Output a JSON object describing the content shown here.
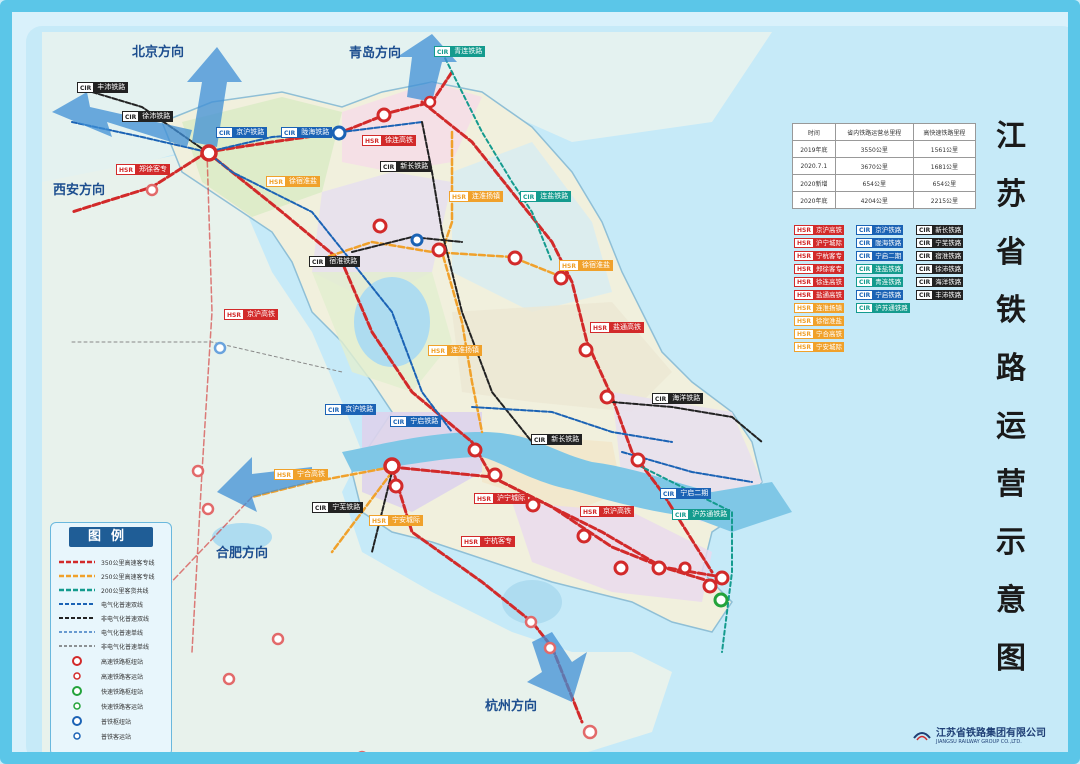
{
  "title_chars": [
    "江",
    "苏",
    "省",
    "铁",
    "路",
    "运",
    "营",
    "示",
    "意",
    "图"
  ],
  "directions": {
    "beijing": "北京方向",
    "qingdao": "青岛方向",
    "xian": "西安方向",
    "hefei": "合肥方向",
    "hangzhou": "杭州方向"
  },
  "stats_table": {
    "headers": [
      "时间",
      "省内铁路运营总里程",
      "高快速铁路里程"
    ],
    "rows": [
      [
        "2019年底",
        "3550公里",
        "1561公里"
      ],
      [
        "2020.7.1",
        "3670公里",
        "1681公里"
      ],
      [
        "2020新增",
        "654公里",
        "654公里"
      ],
      [
        "2020年底",
        "4204公里",
        "2215公里"
      ]
    ]
  },
  "line_tags": {
    "col1": [
      {
        "pre": "HSR",
        "name": "京沪高铁",
        "style": "hsr"
      },
      {
        "pre": "HSR",
        "name": "沪宁城际",
        "style": "hsr"
      },
      {
        "pre": "HSR",
        "name": "宁杭客专",
        "style": "hsr"
      },
      {
        "pre": "HSR",
        "name": "郑徐客专",
        "style": "hsr"
      },
      {
        "pre": "HSR",
        "name": "徐连高铁",
        "style": "hsr"
      },
      {
        "pre": "HSR",
        "name": "盐通高铁",
        "style": "hsr"
      },
      {
        "pre": "HSR",
        "name": "连淮扬镇",
        "style": "org"
      },
      {
        "pre": "HSR",
        "name": "徐宿淮盐",
        "style": "org"
      },
      {
        "pre": "HSR",
        "name": "宁合高铁",
        "style": "org"
      },
      {
        "pre": "HSR",
        "name": "宁安城际",
        "style": "org"
      }
    ],
    "col2": [
      {
        "pre": "CIR",
        "name": "京沪铁路",
        "style": "cirb"
      },
      {
        "pre": "CIR",
        "name": "陇海铁路",
        "style": "cirb"
      },
      {
        "pre": "CIR",
        "name": "宁启二期",
        "style": "cirb"
      },
      {
        "pre": "CIR",
        "name": "连盐铁路",
        "style": "cirt"
      },
      {
        "pre": "CIR",
        "name": "青连铁路",
        "style": "cirt"
      },
      {
        "pre": "CIR",
        "name": "宁启铁路",
        "style": "cirb"
      },
      {
        "pre": "CIR",
        "name": "沪苏通铁路",
        "style": "cirt"
      }
    ],
    "col3": [
      {
        "pre": "CIR",
        "name": "新长铁路",
        "style": "cir"
      },
      {
        "pre": "CIR",
        "name": "宁芜铁路",
        "style": "cir"
      },
      {
        "pre": "CIR",
        "name": "宿淮铁路",
        "style": "cir"
      },
      {
        "pre": "CIR",
        "name": "徐沛铁路",
        "style": "cir"
      },
      {
        "pre": "CIR",
        "name": "海洋铁路",
        "style": "cir"
      },
      {
        "pre": "CIR",
        "name": "丰沛铁路",
        "style": "cir"
      }
    ]
  },
  "map_labels": [
    {
      "id": "fengpei",
      "pre": "CIR",
      "name": "丰沛铁路",
      "style": "cir"
    },
    {
      "id": "xupei",
      "pre": "CIR",
      "name": "徐沛铁路",
      "style": "cir"
    },
    {
      "id": "qinglian",
      "pre": "CIR",
      "name": "青连铁路",
      "style": "cirt"
    },
    {
      "id": "jinghu1",
      "pre": "CIR",
      "name": "京沪铁路",
      "style": "cirb"
    },
    {
      "id": "longhai",
      "pre": "CIR",
      "name": "陇海铁路",
      "style": "cirb"
    },
    {
      "id": "xulian",
      "pre": "HSR",
      "name": "徐连高铁",
      "style": "hsr"
    },
    {
      "id": "zhengxu",
      "pre": "HSR",
      "name": "郑徐客专",
      "style": "hsr"
    },
    {
      "id": "xinchang1",
      "pre": "CIR",
      "name": "新长铁路",
      "style": "cir"
    },
    {
      "id": "xusu",
      "pre": "HSR",
      "name": "徐宿淮盐",
      "style": "org"
    },
    {
      "id": "lianhuai",
      "pre": "HSR",
      "name": "连淮扬镇",
      "style": "org"
    },
    {
      "id": "lianyan",
      "pre": "CIR",
      "name": "连盐铁路",
      "style": "cirt"
    },
    {
      "id": "suhuai",
      "pre": "CIR",
      "name": "宿淮铁路",
      "style": "cir"
    },
    {
      "id": "xusu2",
      "pre": "HSR",
      "name": "徐宿淮盐",
      "style": "org"
    },
    {
      "id": "yantong",
      "pre": "HSR",
      "name": "盐通高铁",
      "style": "hsr"
    },
    {
      "id": "jinghuHSR",
      "pre": "HSR",
      "name": "京沪高铁",
      "style": "hsr"
    },
    {
      "id": "lianhuai2",
      "pre": "HSR",
      "name": "连淮扬镇",
      "style": "org"
    },
    {
      "id": "haiyang",
      "pre": "CIR",
      "name": "海洋铁路",
      "style": "cir"
    },
    {
      "id": "jinghu2",
      "pre": "CIR",
      "name": "京沪铁路",
      "style": "cirb"
    },
    {
      "id": "ningqi",
      "pre": "CIR",
      "name": "宁启铁路",
      "style": "cirb"
    },
    {
      "id": "xinchang2",
      "pre": "CIR",
      "name": "新长铁路",
      "style": "cir"
    },
    {
      "id": "ninghe",
      "pre": "HSR",
      "name": "宁合高铁",
      "style": "org"
    },
    {
      "id": "ninghu",
      "pre": "HSR",
      "name": "沪宁城际",
      "style": "hsr"
    },
    {
      "id": "ningqi2",
      "pre": "CIR",
      "name": "宁启二期",
      "style": "cirb"
    },
    {
      "id": "ningwu",
      "pre": "CIR",
      "name": "宁芜铁路",
      "style": "cir"
    },
    {
      "id": "ningan",
      "pre": "HSR",
      "name": "宁安城际",
      "style": "org"
    },
    {
      "id": "jinghu3",
      "pre": "HSR",
      "name": "京沪高铁",
      "style": "hsr"
    },
    {
      "id": "husutong",
      "pre": "CIR",
      "name": "沪苏通铁路",
      "style": "cirt"
    },
    {
      "id": "ninghang",
      "pre": "HSR",
      "name": "宁杭客专",
      "style": "hsr"
    }
  ],
  "legend": {
    "title": "图例",
    "items": [
      {
        "text": "350公里高速客专线",
        "sym": "red-dash"
      },
      {
        "text": "250公里高速客专线",
        "sym": "orange-dash"
      },
      {
        "text": "200公里客货共线",
        "sym": "teal-dash"
      },
      {
        "text": "电气化普速双线",
        "sym": "blue-dash"
      },
      {
        "text": "非电气化普速双线",
        "sym": "black-dash"
      },
      {
        "text": "电气化普速单线",
        "sym": "blue-thin"
      },
      {
        "text": "非电气化普速单线",
        "sym": "gray-thin"
      },
      {
        "text": "高速铁路枢纽站",
        "sym": "red-ring"
      },
      {
        "text": "高速铁路客运站",
        "sym": "red-dot"
      },
      {
        "text": "快速铁路枢纽站",
        "sym": "green-ring"
      },
      {
        "text": "快速铁路客运站",
        "sym": "green-dot"
      },
      {
        "text": "普铁枢纽站",
        "sym": "blue-ring"
      },
      {
        "text": "普铁客运站",
        "sym": "blue-dot"
      }
    ]
  },
  "company": {
    "name_cn": "江苏省铁路集团有限公司",
    "name_en": "JIANGSU RAILWAY GROUP CO.,LTD."
  },
  "colors": {
    "hsr": "#d22a2a",
    "orange": "#f0a12b",
    "teal": "#149b8e",
    "blue": "#1b63b5",
    "sea": "#bfe6f5",
    "land": "#f2f4e6"
  }
}
